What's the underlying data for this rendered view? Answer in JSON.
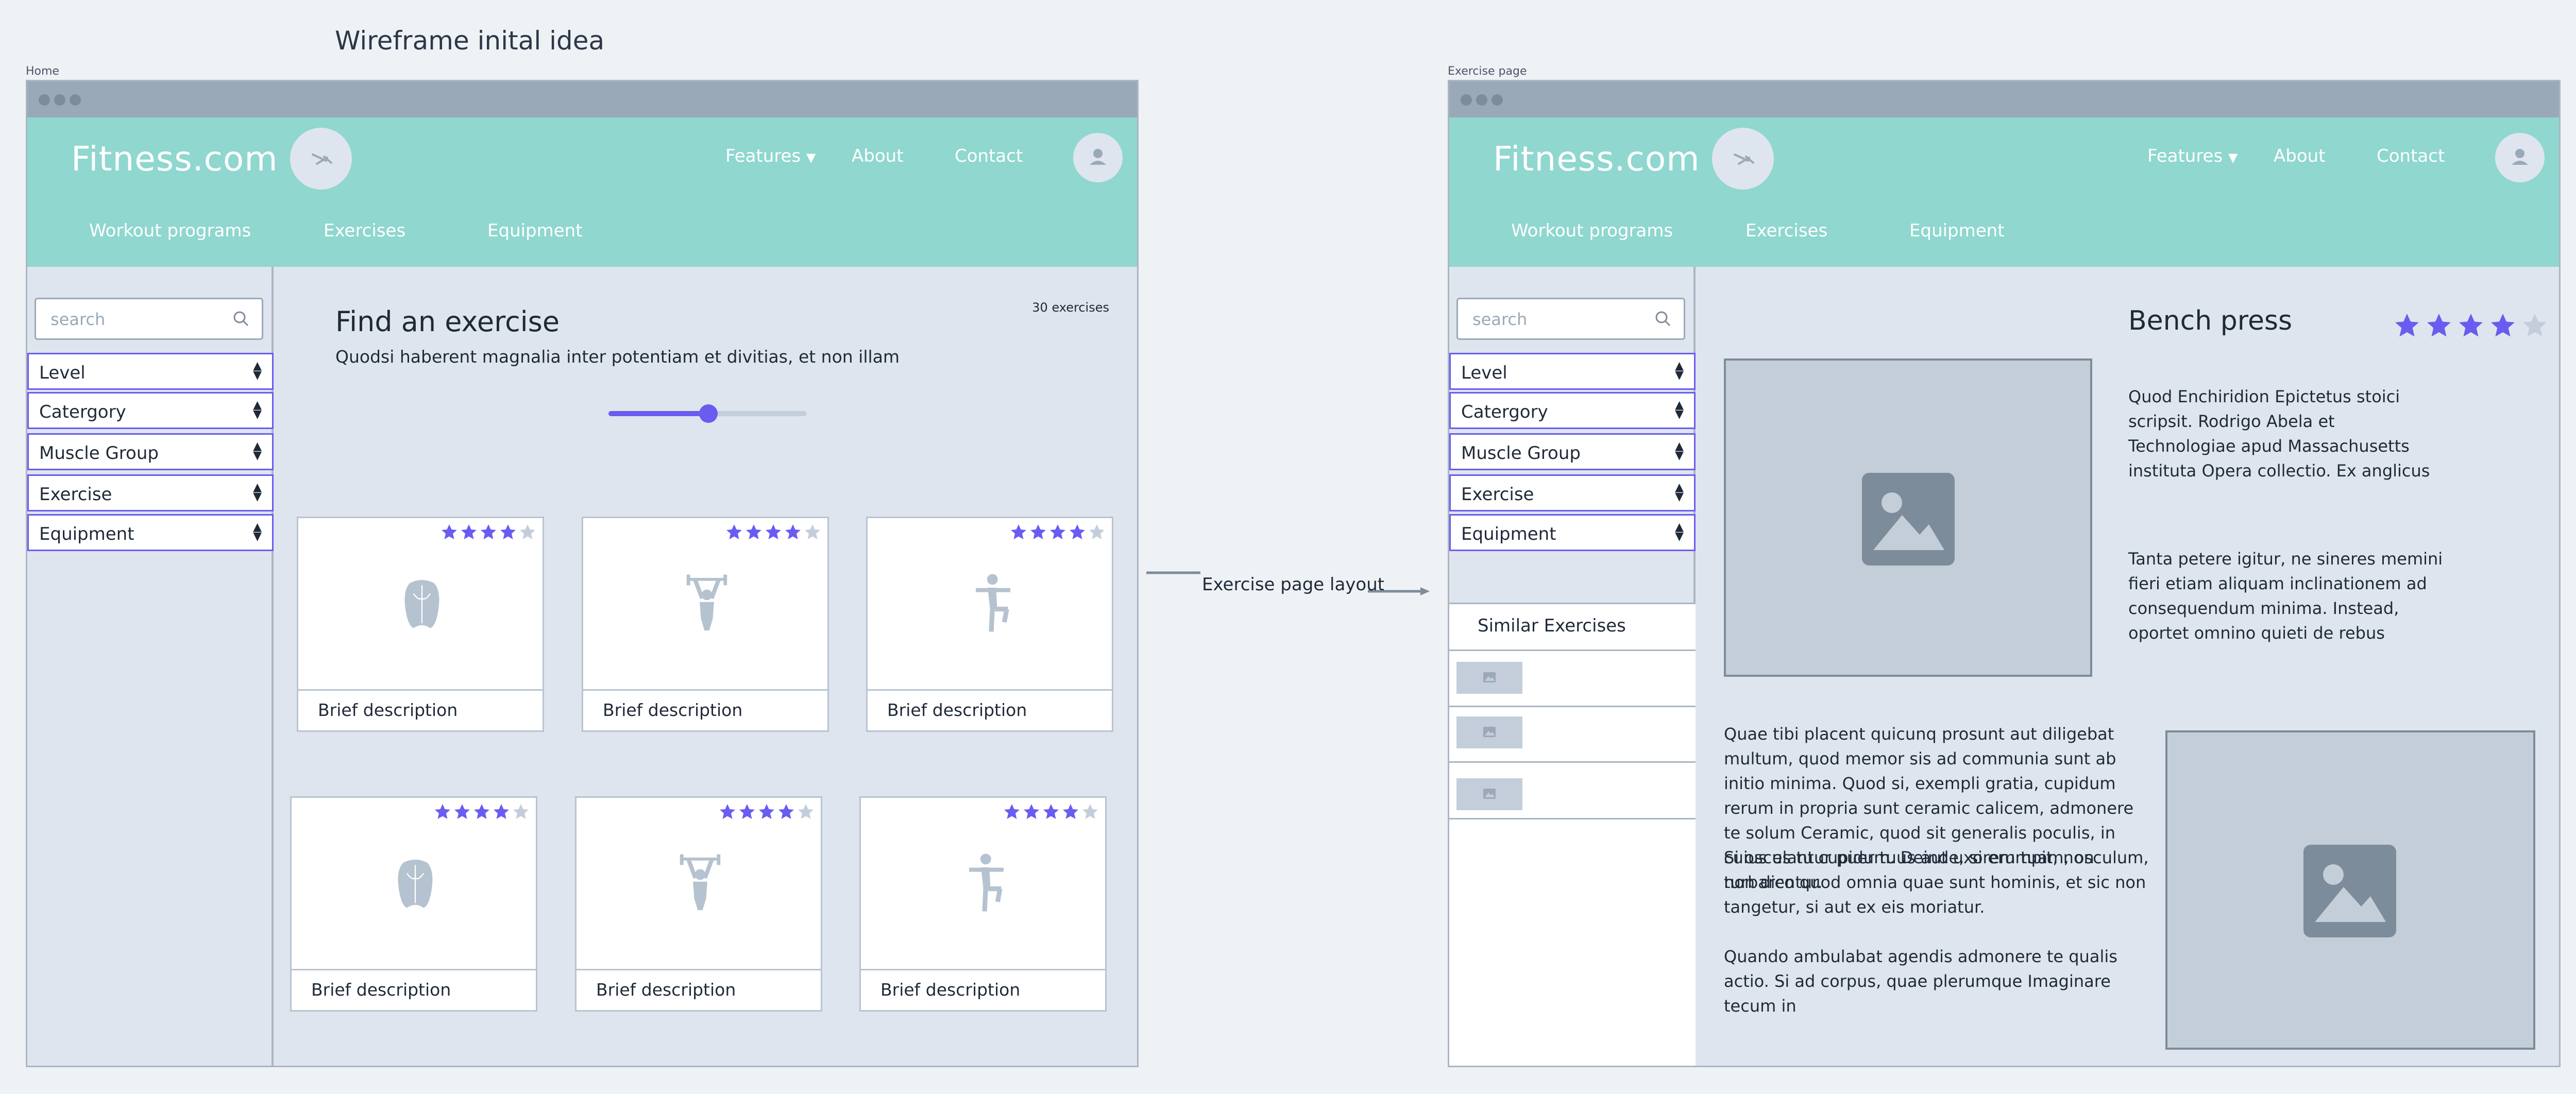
{
  "canvas": {
    "title": "Wireframe inital idea",
    "connector_label": "Exercise page layout"
  },
  "colors": {
    "header": "#8fd7cf",
    "accent": "#6a5cf0",
    "frame_bg": "#dfe5ee",
    "placeholder": "#c4ced8"
  },
  "home": {
    "frame_label": "Home",
    "logo": "Fitness.com",
    "nav": {
      "features": "Features",
      "about": "About",
      "contact": "Contact"
    },
    "subnav": [
      "Workout programs",
      "Exercises",
      "Equipment"
    ],
    "search": {
      "placeholder": "search"
    },
    "filters": [
      "Level",
      "Catergory",
      "Muscle Group",
      "Exercise",
      "Equipment"
    ],
    "main": {
      "title": "Find an exercise",
      "subtitle": "Quodsi haberent magnalia inter potentiam et divitias, et non illam",
      "count": "30 exercises",
      "slider_value": 0.5
    },
    "cards": [
      {
        "icon": "back-muscle-icon",
        "description": "Brief description",
        "rating": 4,
        "rating_max": 5
      },
      {
        "icon": "weightlifter-icon",
        "description": "Brief description",
        "rating": 4,
        "rating_max": 5
      },
      {
        "icon": "stretching-person-icon",
        "description": "Brief description",
        "rating": 4,
        "rating_max": 5
      },
      {
        "icon": "back-muscle-icon",
        "description": "Brief description",
        "rating": 4,
        "rating_max": 5
      },
      {
        "icon": "weightlifter-icon",
        "description": "Brief description",
        "rating": 4,
        "rating_max": 5
      },
      {
        "icon": "stretching-person-icon",
        "description": "Brief description",
        "rating": 4,
        "rating_max": 5
      }
    ]
  },
  "exercise_page": {
    "frame_label": "Exercise page",
    "logo": "Fitness.com",
    "nav": {
      "features": "Features",
      "about": "About",
      "contact": "Contact"
    },
    "subnav": [
      "Workout programs",
      "Exercises",
      "Equipment"
    ],
    "search": {
      "placeholder": "search"
    },
    "filters": [
      "Level",
      "Catergory",
      "Muscle Group",
      "Exercise",
      "Equipment"
    ],
    "similar_title": "Similar Exercises",
    "title": "Bench press",
    "rating": 4,
    "rating_max": 5,
    "para1": "Quod Enchiridion Epictetus stoici scripsit. Rodrigo Abela et Technologiae apud Massachusetts instituta Opera collectio. Ex anglicus",
    "para2": "Tanta petere igitur, ne sineres memini fieri etiam aliquam inclinationem ad consequendum minima. Instead, oportet omnino quieti de rebus",
    "para3": "Quae tibi placent quicunq prosunt aut diligebat multum, quod memor sis ad communia sunt ab initio minima. Quod si, exempli gratia, cupidum rerum in propria sunt ceramic calicem, admonere te solum Ceramic, quod sit generalis poculis, in cuius es tu cupidum. Deinde, si erumpit, non turbarentur.",
    "para4": "Si osculantur puer tuus aut uxorem tuam, osculum, non dico quod omnia quae sunt hominis, et sic non tangetur, si aut ex eis moriatur.",
    "para5": "Quando ambulabat agendis admonere te qualis actio. Si ad corpus, quae plerumque Imaginare tecum in"
  }
}
